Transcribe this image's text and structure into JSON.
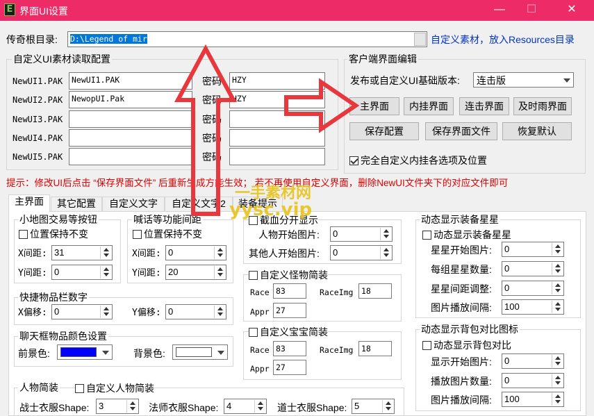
{
  "window": {
    "icon": "E",
    "title": "界面UI设置",
    "min": "—",
    "max": "☐",
    "close": "✕"
  },
  "root": {
    "label": "传奇根目录:",
    "value": "D:\\Legend of mir",
    "hint": "自定义素材，放入Resources目录"
  },
  "pak": {
    "group": "自定义UI素材读取配置",
    "pwd_label": "密码",
    "rows": [
      {
        "label": "NewUI1.PAK",
        "file": "NewUI1.PAK",
        "pwd": "HZY"
      },
      {
        "label": "NewUI2.PAK",
        "file": "NewopUI.Pak",
        "pwd": "HZY"
      },
      {
        "label": "NewUI3.PAK",
        "file": "",
        "pwd": ""
      },
      {
        "label": "NewUI4.PAK",
        "file": "",
        "pwd": ""
      },
      {
        "label": "NewUI5.PAK",
        "file": "",
        "pwd": ""
      }
    ]
  },
  "client": {
    "group": "客户端界面编辑",
    "version_label": "发布或自定义UI基础版本:",
    "version_value": "连击版",
    "b1": "主界面",
    "b2": "内挂界面",
    "b3": "连击界面",
    "b4": "及时雨界面",
    "b5": "保存配置",
    "b6": "保存界面文件",
    "b7": "恢复默认",
    "full_custom": "完全自定义内挂各选项及位置"
  },
  "hint_text": "提示：修改UI后点击 “保存界面文件” 后重新生成方能生效；   若不再使用自定义界面，删除NewUI文件夹下的对应文件即可",
  "tabs": [
    "主界面",
    "其它配置",
    "自定义文字",
    "自定义文字2",
    "装备提示"
  ],
  "minimap": {
    "group": "小地图交易等按钮",
    "keep": "位置保持不变",
    "x_label": "X间距:",
    "x": "31",
    "y_label": "Y间距:",
    "y": "0"
  },
  "shout": {
    "group": "喊话等功能间距",
    "keep": "位置保持不变",
    "x_label": "X间距:",
    "x": "0",
    "y_label": "Y间距:",
    "y": "20"
  },
  "hotbar": {
    "group": "快捷物品栏数字",
    "x_label": "X偏移:",
    "x": "0",
    "y_label": "Y偏移:",
    "y": "0"
  },
  "chatcolor": {
    "group": "聊天框物品颜色设置",
    "fg_label": "前景色:",
    "bg_label": "背景色:",
    "fg_color": "#0000ff",
    "bg_color": "#ffffff"
  },
  "figure": {
    "group": "人物简装",
    "custom": "自定义人物简装",
    "warrior": "战士衣服Shape:",
    "warrior_v": "3",
    "mage": "法师衣服Shape:",
    "mage_v": "4",
    "taoist": "道士衣服Shape:",
    "taoist_v": "5"
  },
  "split": {
    "check": "截血分开显示",
    "self": "人物开始图片:",
    "self_v": "0",
    "other": "其他人开始图片:",
    "other_v": "0"
  },
  "monster": {
    "check": "自定义怪物简装",
    "race": "Race",
    "race_v": "83",
    "raceimg": "RaceImg",
    "raceimg_v": "18",
    "appr": "Appr",
    "appr_v": "27"
  },
  "baby": {
    "check": "自定义宝宝简装",
    "race": "Race",
    "race_v": "83",
    "raceimg": "RaceImg",
    "raceimg_v": "18",
    "appr": "Appr",
    "appr_v": "27"
  },
  "stars": {
    "group": "动态显示装备星星",
    "check": "动态显示装备星星",
    "start": "星星开始图片:",
    "start_v": "0",
    "count": "每组星星数量:",
    "count_v": "0",
    "spacing": "星星间距调整:",
    "spacing_v": "0",
    "interval": "图片播放间隔:",
    "interval_v": "100"
  },
  "bag": {
    "group": "动态显示背包对比图标",
    "check": "动态显示背包对比",
    "start": "显示开始图片:",
    "start_v": "0",
    "count": "播放图片数量:",
    "count_v": "0",
    "interval": "图片播放间隔:",
    "interval_v": "100"
  },
  "watermark": {
    "cn": "一手素材网",
    "en": "yysc.vip"
  },
  "colors": {
    "title": "#ec2b67",
    "hint": "#e00000",
    "arrow": "#e8383d"
  }
}
